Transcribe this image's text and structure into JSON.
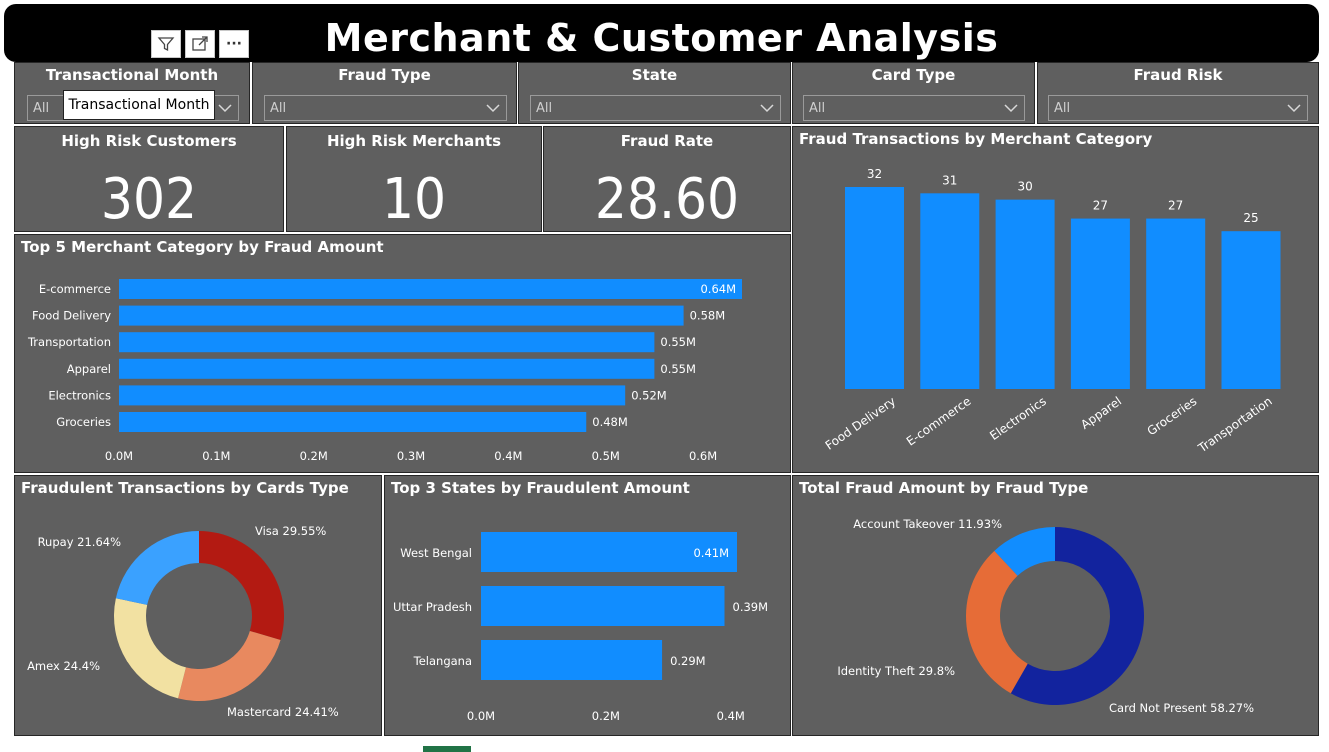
{
  "header": {
    "title": "Merchant & Customer Analysis",
    "toolbar_icons": [
      "filter-icon",
      "focus-mode-icon",
      "more-options-icon"
    ],
    "more_label": "···"
  },
  "slicers": [
    {
      "title": "Transactional Month",
      "value": "All"
    },
    {
      "title": "Fraud Type",
      "value": "All"
    },
    {
      "title": "State",
      "value": "All"
    },
    {
      "title": "Card Type",
      "value": "All"
    },
    {
      "title": "Fraud Risk",
      "value": "All"
    }
  ],
  "tooltip": {
    "text": "Transactional Month"
  },
  "kpis": [
    {
      "title": "High Risk Customers",
      "value": "302"
    },
    {
      "title": "High Risk Merchants",
      "value": "10"
    },
    {
      "title": "Fraud Rate",
      "value": "28.60"
    }
  ],
  "colors": {
    "panel": "#5f5f5f",
    "bar": "#118dff",
    "visa": "#b31a12",
    "mastercard": "#e8895f",
    "amex": "#f2e1a2",
    "rupay": "#3aa1ff",
    "card_not_present": "#12239e",
    "identity_theft": "#e66c37",
    "account_takeover": "#118dff"
  },
  "chart_data": [
    {
      "id": "top5",
      "type": "bar",
      "orientation": "horizontal",
      "title": "Top 5 Merchant Category by Fraud Amount",
      "categories": [
        "E-commerce",
        "Food Delivery",
        "Transportation",
        "Apparel",
        "Electronics",
        "Groceries"
      ],
      "values": [
        0.64,
        0.58,
        0.55,
        0.55,
        0.52,
        0.48
      ],
      "data_labels": [
        "0.64M",
        "0.58M",
        "0.55M",
        "0.55M",
        "0.52M",
        "0.48M"
      ],
      "xticks": [
        "0.0M",
        "0.1M",
        "0.2M",
        "0.3M",
        "0.4M",
        "0.5M",
        "0.6M"
      ],
      "xlim": [
        0,
        0.64
      ]
    },
    {
      "id": "merchantcat",
      "type": "bar",
      "orientation": "vertical",
      "title": "Fraud Transactions by Merchant Category",
      "categories": [
        "Food Delivery",
        "E-commerce",
        "Electronics",
        "Apparel",
        "Groceries",
        "Transportation"
      ],
      "values": [
        32,
        31,
        30,
        27,
        27,
        25
      ],
      "ylim": [
        0,
        32
      ]
    },
    {
      "id": "cards",
      "type": "pie",
      "donut": true,
      "title": "Fraudulent Transactions by Cards Type",
      "labels": [
        "Visa",
        "Mastercard",
        "Amex",
        "Rupay"
      ],
      "values": [
        29.55,
        24.41,
        24.4,
        21.64
      ],
      "display_labels": [
        "Visa 29.55%",
        "Mastercard 24.41%",
        "Amex 24.4%",
        "Rupay 21.64%"
      ]
    },
    {
      "id": "states",
      "type": "bar",
      "orientation": "horizontal",
      "title": "Top 3 States by Fraudulent Amount",
      "categories": [
        "West Bengal",
        "Uttar Pradesh",
        "Telangana"
      ],
      "values": [
        0.41,
        0.39,
        0.29
      ],
      "data_labels": [
        "0.41M",
        "0.39M",
        "0.29M"
      ],
      "xticks": [
        "0.0M",
        "0.2M",
        "0.4M"
      ],
      "xlim": [
        0,
        0.41
      ]
    },
    {
      "id": "fraudtype",
      "type": "pie",
      "donut": true,
      "title": "Total Fraud Amount by Fraud Type",
      "labels": [
        "Card Not Present",
        "Identity Theft",
        "Account Takeover"
      ],
      "values": [
        58.27,
        29.8,
        11.93
      ],
      "display_labels": [
        "Card Not Present 58.27%",
        "Identity Theft 29.8%",
        "Account Takeover 11.93%"
      ]
    }
  ]
}
